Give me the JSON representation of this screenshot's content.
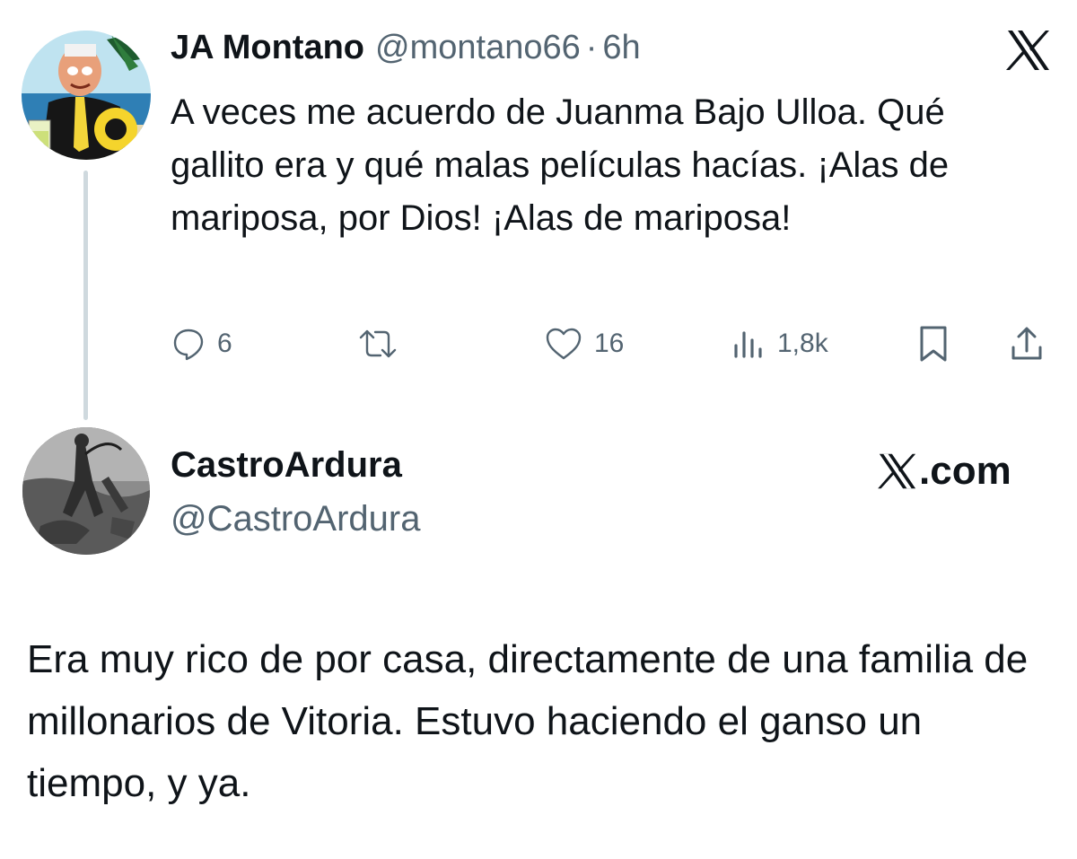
{
  "tweet": {
    "display_name": "JA Montano",
    "handle": "@montano66",
    "separator": "·",
    "time": "6h",
    "text": "A veces me acuerdo de Juanma Bajo Ulloa. Qué gallito era y qué malas películas hacías. ¡Alas de mariposa, por Dios! ¡Alas de mariposa!",
    "actions": {
      "reply_count": "6",
      "retweet_count": "",
      "like_count": "16",
      "views_count": "1,8k"
    },
    "icons": [
      "reply-icon",
      "retweet-icon",
      "like-icon",
      "views-icon",
      "bookmark-icon",
      "share-icon"
    ],
    "brand_icon": "x-logo-icon"
  },
  "quoted": {
    "display_name": "CastroArdura",
    "handle": "@CastroArdura",
    "source_label": ".com",
    "text": "Era muy rico de por casa, directamente de una familia de millonarios de Vitoria. Estuvo haciendo el ganso un tiempo, y ya."
  },
  "colors": {
    "text_primary": "#0f1419",
    "text_secondary": "#536471",
    "thread_line": "#cfd9de"
  }
}
